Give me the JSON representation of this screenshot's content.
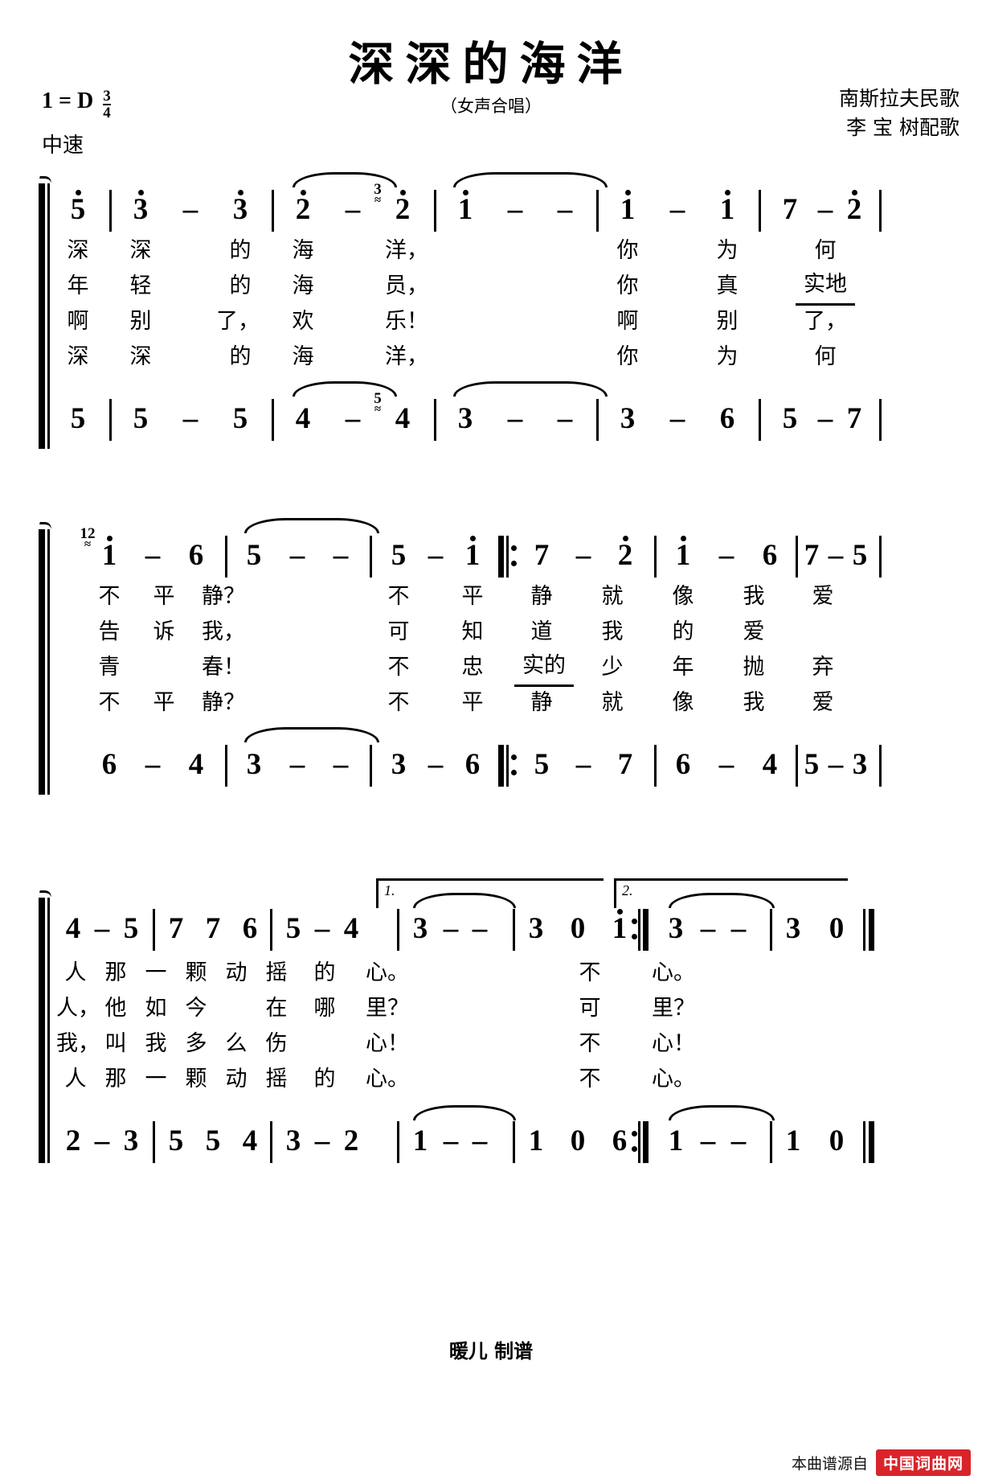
{
  "header": {
    "title": "深深的海洋",
    "subtitle": "（女声合唱）",
    "key_signature": "1 = D",
    "time_sig_num": "3",
    "time_sig_den": "4",
    "tempo": "中速",
    "credit_line_1": "南斯拉夫民歌",
    "credit_line_2": "李 宝 树配歌"
  },
  "footer": {
    "engraver": "暖儿 制谱",
    "source_label": "本曲谱源自",
    "source_site": "中国词曲网"
  },
  "systems": [
    {
      "id": "system-1",
      "melody": [
        "5",
        "3",
        "–",
        "3",
        "2",
        "–",
        "2",
        "1",
        "–",
        "–",
        "1",
        "–",
        "1",
        "7",
        "–",
        "2"
      ],
      "bass": [
        "5",
        "5",
        "–",
        "5",
        "4",
        "–",
        "4",
        "3",
        "–",
        "–",
        "3",
        "–",
        "6",
        "5",
        "–",
        "7"
      ],
      "grace_melody": "3",
      "grace_bass": "5",
      "lyrics": [
        [
          "深",
          "深",
          "的",
          "海",
          "洋，",
          "你",
          "为",
          "何"
        ],
        [
          "年",
          "轻",
          "的",
          "海",
          "员，",
          "你",
          "真",
          "实地"
        ],
        [
          "啊",
          "别",
          "了，",
          "欢",
          "乐！",
          "啊",
          "别",
          "了，"
        ],
        [
          "深",
          "深",
          "的",
          "海",
          "洋，",
          "你",
          "为",
          "何"
        ]
      ]
    },
    {
      "id": "system-2",
      "melody": [
        "1",
        "–",
        "6",
        "5",
        "–",
        "–",
        "5",
        "–",
        "1",
        "7",
        "–",
        "2",
        "1",
        "–",
        "6",
        "7",
        "–",
        "5"
      ],
      "bass": [
        "6",
        "–",
        "4",
        "3",
        "–",
        "–",
        "3",
        "–",
        "6",
        "5",
        "–",
        "7",
        "6",
        "–",
        "4",
        "5",
        "–",
        "3"
      ],
      "grace_melody": "12",
      "lyrics": [
        [
          "不",
          "平",
          "静？",
          "不",
          "平",
          "静",
          "就",
          "像",
          "我",
          "爱"
        ],
        [
          "告",
          "诉",
          "我，",
          "可",
          "知",
          "道",
          "我",
          "的",
          "爱"
        ],
        [
          "青",
          "春！",
          "不",
          "忠",
          "实的",
          "少",
          "年",
          "抛",
          "弃"
        ],
        [
          "不",
          "平",
          "静？",
          "不",
          "平",
          "静",
          "就",
          "像",
          "我",
          "爱"
        ]
      ]
    },
    {
      "id": "system-3",
      "melody": [
        "4",
        "–",
        "5",
        "7",
        "7",
        "6",
        "5",
        "–",
        "4",
        "3",
        "–",
        "–",
        "3",
        "0",
        "1",
        "3",
        "–",
        "–",
        "3",
        "0"
      ],
      "bass": [
        "2",
        "–",
        "3",
        "5",
        "5",
        "4",
        "3",
        "–",
        "2",
        "1",
        "–",
        "–",
        "1",
        "0",
        "6",
        "1",
        "–",
        "–",
        "1",
        "0"
      ],
      "volta_1": "1.",
      "volta_2": "2.",
      "lyrics": [
        [
          "人",
          "那",
          "一",
          "颗",
          "动",
          "摇",
          "的",
          "心。",
          "不",
          "心。"
        ],
        [
          "人，",
          "他",
          "如",
          "今",
          "在",
          "哪",
          "里？",
          "可",
          "里？"
        ],
        [
          "我，",
          "叫",
          "我",
          "多",
          "么",
          "伤",
          "心！",
          "不",
          "心！"
        ],
        [
          "人",
          "那",
          "一",
          "颗",
          "动",
          "摇",
          "的",
          "心。",
          "不",
          "心。"
        ]
      ]
    }
  ]
}
